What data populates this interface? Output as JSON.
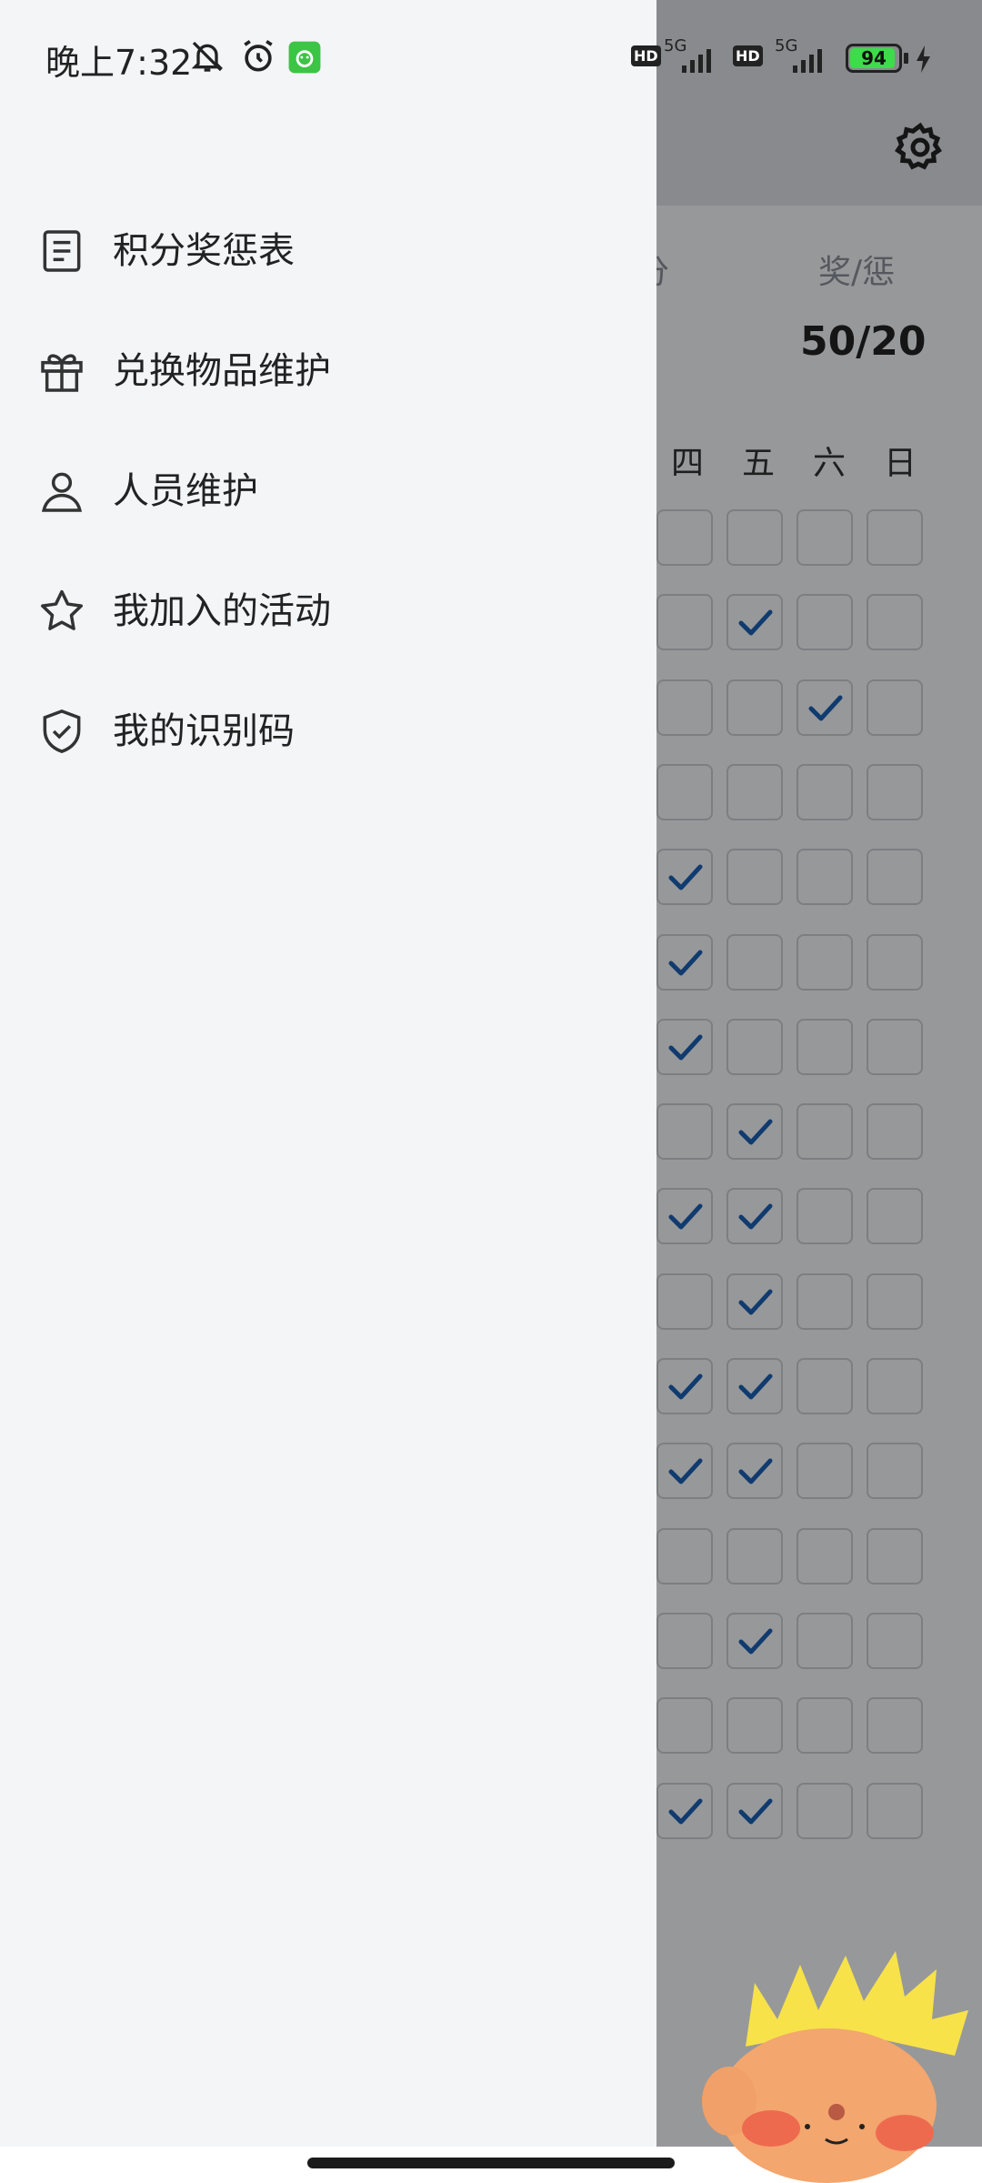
{
  "status_bar": {
    "time": "晚上7:32",
    "battery_level": 94,
    "battery_text": "94",
    "network_1": "5G",
    "network_2": "5G",
    "hd_1": "HD",
    "hd_2": "HD"
  },
  "drawer": {
    "items": [
      {
        "label": "积分奖惩表",
        "icon": "list-icon"
      },
      {
        "label": "兑换物品维护",
        "icon": "gift-icon"
      },
      {
        "label": "人员维护",
        "icon": "person-icon"
      },
      {
        "label": "我加入的活动",
        "icon": "star-icon"
      },
      {
        "label": "我的识别码",
        "icon": "shield-check-icon"
      }
    ]
  },
  "background": {
    "summary_label_partial": "分",
    "summary_label_2": "奖/惩",
    "summary_value": "50/20",
    "day_headers": [
      "四",
      "五",
      "六",
      "日"
    ],
    "check_rows": [
      [
        false,
        false,
        false,
        false
      ],
      [
        false,
        true,
        false,
        false
      ],
      [
        false,
        false,
        true,
        false
      ],
      [
        false,
        false,
        false,
        false
      ],
      [
        true,
        false,
        false,
        false
      ],
      [
        true,
        false,
        false,
        false
      ],
      [
        true,
        false,
        false,
        false
      ],
      [
        false,
        true,
        false,
        false
      ],
      [
        true,
        true,
        false,
        false
      ],
      [
        false,
        true,
        false,
        false
      ],
      [
        true,
        true,
        false,
        false
      ],
      [
        true,
        true,
        false,
        false
      ],
      [
        false,
        false,
        false,
        false
      ],
      [
        false,
        true,
        false,
        false
      ],
      [
        false,
        false,
        false,
        false
      ],
      [
        true,
        true,
        false,
        false
      ]
    ]
  },
  "colors": {
    "drawer_bg": "#f3f5f7",
    "check_blue": "#1a5fb4",
    "battery_green": "#3ddc4a"
  }
}
